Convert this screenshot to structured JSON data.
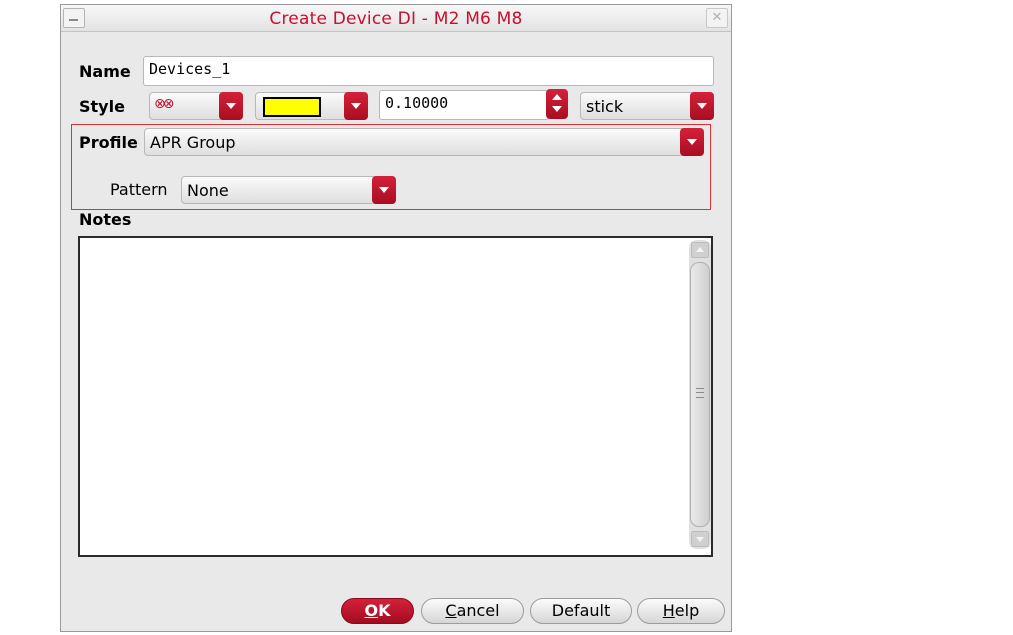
{
  "window": {
    "title": "Create Device DI - M2 M6 M8",
    "close_glyph": "✕"
  },
  "form": {
    "name_label": "Name",
    "name_value": "Devices_1",
    "style_label": "Style",
    "line_style_glyph": "⊗⊗",
    "color_value": "#ffff00",
    "width_value": "0.10000",
    "draw_mode_value": "stick",
    "profile_label": "Profile",
    "profile_value": "APR Group",
    "pattern_label": "Pattern",
    "pattern_value": "None",
    "notes_label": "Notes",
    "notes_value": ""
  },
  "buttons": {
    "ok": {
      "mnemonic": "O",
      "rest": "K"
    },
    "cancel": {
      "mnemonic": "C",
      "rest": "ancel"
    },
    "default": {
      "label": "Default"
    },
    "help": {
      "mnemonic": "H",
      "rest": "elp"
    }
  },
  "colors": {
    "accent_red": "#c8102e",
    "swatch_yellow": "#ffff00",
    "dialog_bg": "#e9e9e9"
  },
  "icons": {
    "window_menu": "window-menu-icon",
    "close": "close-icon",
    "dropdown": "chevron-down-icon",
    "spin": "spin-updown-icon",
    "scroll_up": "scroll-up-arrow-icon",
    "scroll_down": "scroll-down-arrow-icon"
  }
}
